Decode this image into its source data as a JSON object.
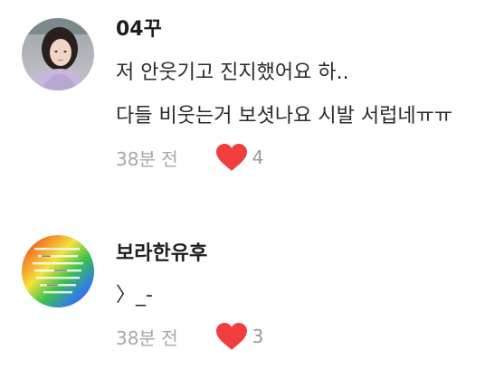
{
  "comments": [
    {
      "username": "04꾸",
      "avatar": "profile-photo-icon",
      "lines": [
        "저 안웃기고 진지했어요 하..",
        "다들 비웃는거 보셧나요 시발 서럽네ㅠㅠ"
      ],
      "time": "38분 전",
      "likes": "4"
    },
    {
      "username": "보라한유후",
      "avatar": "rainbow-text-image-icon",
      "lines": [
        "〉_-"
      ],
      "time": "38분 전",
      "likes": "3"
    }
  ],
  "colors": {
    "heart": "#f03e3e",
    "meta_text": "#a7a7a7"
  }
}
